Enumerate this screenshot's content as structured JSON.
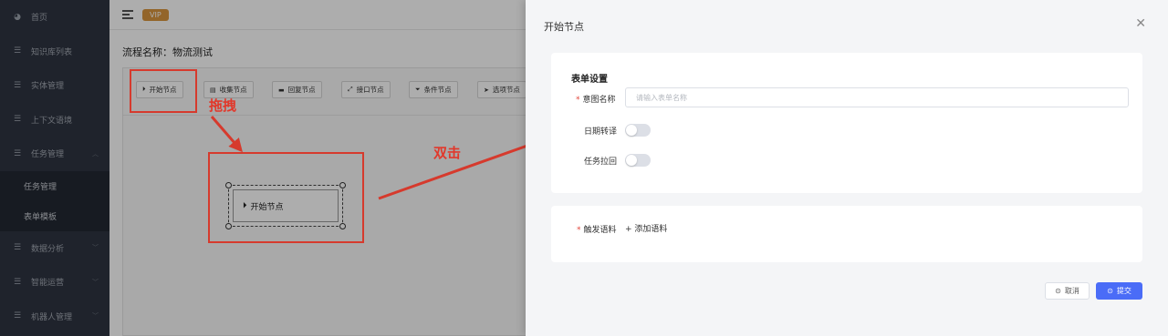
{
  "sidebar": {
    "items": [
      {
        "label": "首页",
        "icon": "dashboard-icon"
      },
      {
        "label": "知识库列表",
        "icon": "list-icon"
      },
      {
        "label": "实体管理",
        "icon": "list-icon"
      },
      {
        "label": "上下文语境",
        "icon": "list-icon"
      },
      {
        "label": "任务管理",
        "icon": "list-icon",
        "expanded": true
      },
      {
        "label": "数据分析",
        "icon": "list-icon"
      },
      {
        "label": "智能运营",
        "icon": "list-icon"
      },
      {
        "label": "机器人管理",
        "icon": "list-icon"
      }
    ],
    "sub_items": [
      "任务管理",
      "表单模板"
    ]
  },
  "header": {
    "vip_badge": "VIP"
  },
  "flow": {
    "title": "流程名称：物流测试",
    "nodes": [
      {
        "label": "开始节点",
        "icon": "play-circle-icon"
      },
      {
        "label": "收集节点",
        "icon": "collect-icon"
      },
      {
        "label": "回复节点",
        "icon": "chat-icon"
      },
      {
        "label": "接口节点",
        "icon": "api-icon"
      },
      {
        "label": "条件节点",
        "icon": "filter-icon"
      },
      {
        "label": "选项节点",
        "icon": "pointer-icon"
      }
    ],
    "canvas_node_label": "开始节点"
  },
  "annotations": {
    "drag": "拖拽",
    "double_click": "双击",
    "color": "#d63a2d"
  },
  "drawer": {
    "title": "开始节点",
    "form_section": "表单设置",
    "intent_label": "意图名称",
    "intent_placeholder": "请输入表单名称",
    "date_label": "日期转译",
    "task_label": "任务拉回",
    "trigger_label": "触发语料",
    "add_corpus": "+ 添加语料",
    "cancel": "取消",
    "submit": "提交"
  },
  "colors": {
    "primary": "#4a6cf7",
    "sidebar": "#2e3441",
    "vip": "#d9963f",
    "required": "#e2453a"
  }
}
